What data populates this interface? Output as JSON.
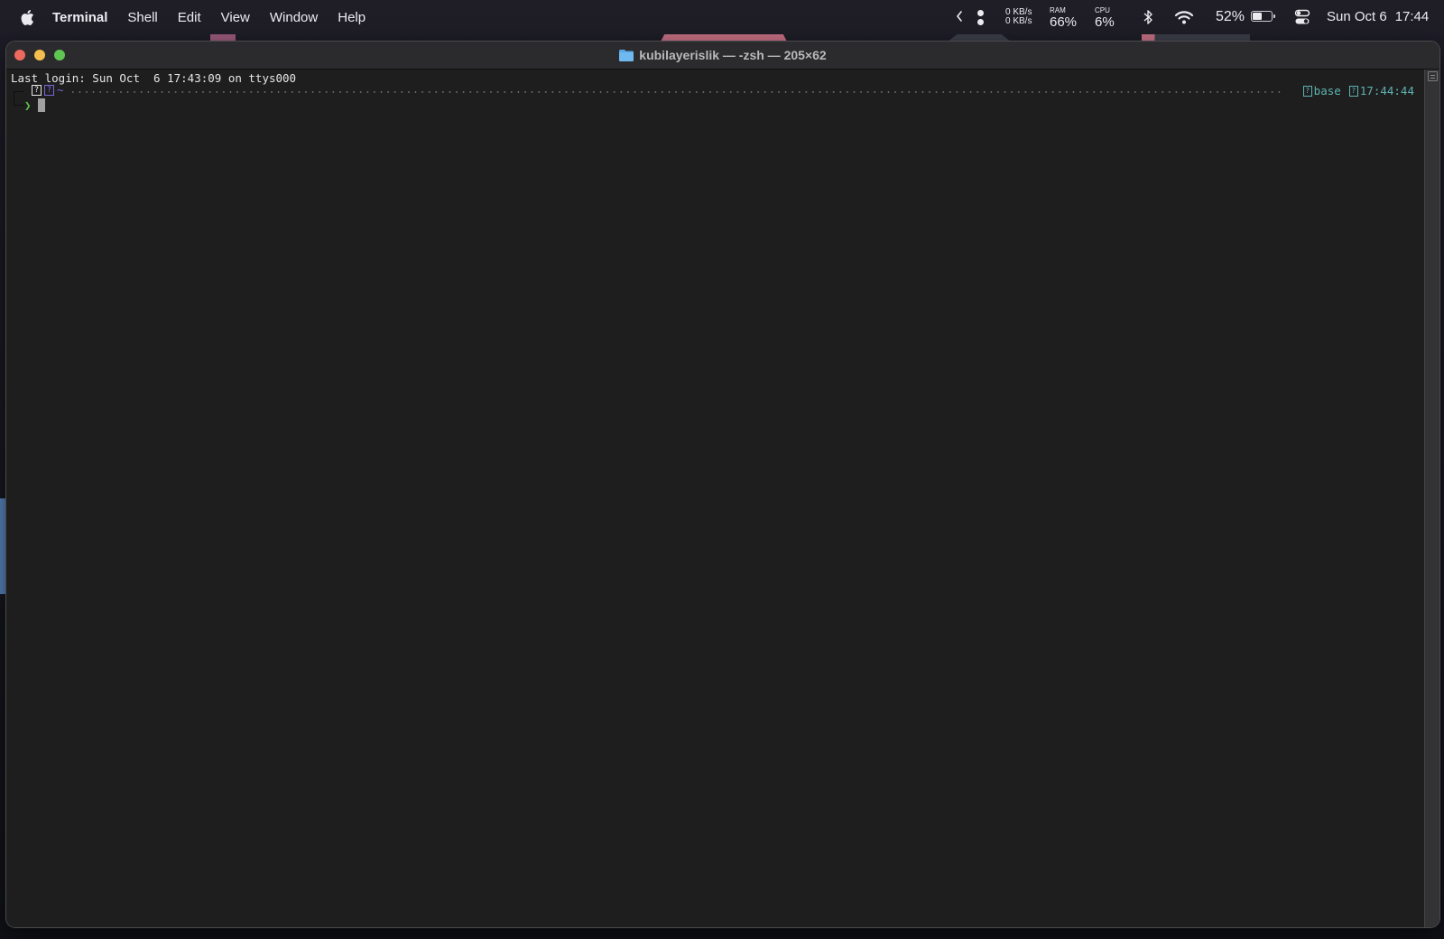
{
  "menubar": {
    "app_name": "Terminal",
    "menus": [
      "Shell",
      "Edit",
      "View",
      "Window",
      "Help"
    ],
    "status": {
      "network_up": "0 KB/s",
      "network_down": "0 KB/s",
      "ram_label": "RAM",
      "ram_value": "66%",
      "cpu_label": "CPU",
      "cpu_value": "6%",
      "battery_percent": "52%",
      "battery_level": 0.52,
      "date": "Sun Oct 6",
      "time": "17:44"
    },
    "icons": [
      "apple-icon",
      "chevron-left-icon",
      "dots-icon",
      "bluetooth-icon",
      "wifi-icon",
      "battery-icon",
      "control-center-icon"
    ]
  },
  "window": {
    "title": "kubilayerislik — -zsh — 205×62",
    "title_icon": "folder-icon",
    "colors": {
      "close": "#ed6a5e",
      "minimize": "#f5bf4f",
      "maximize": "#61c554"
    }
  },
  "terminal": {
    "last_login": "Last login: Sun Oct  6 17:43:09 on ttys000",
    "prompt": {
      "os_glyph": "?",
      "dir_glyph": "?",
      "directory": "~",
      "env_glyph": "?",
      "env_name": "base",
      "time_glyph": "?",
      "time": "17:44:44",
      "symbol": "❯"
    },
    "colors": {
      "dir": "#7c66d9",
      "right_prompt": "#5fb3b3",
      "prompt_symbol": "#5fc24a"
    }
  }
}
